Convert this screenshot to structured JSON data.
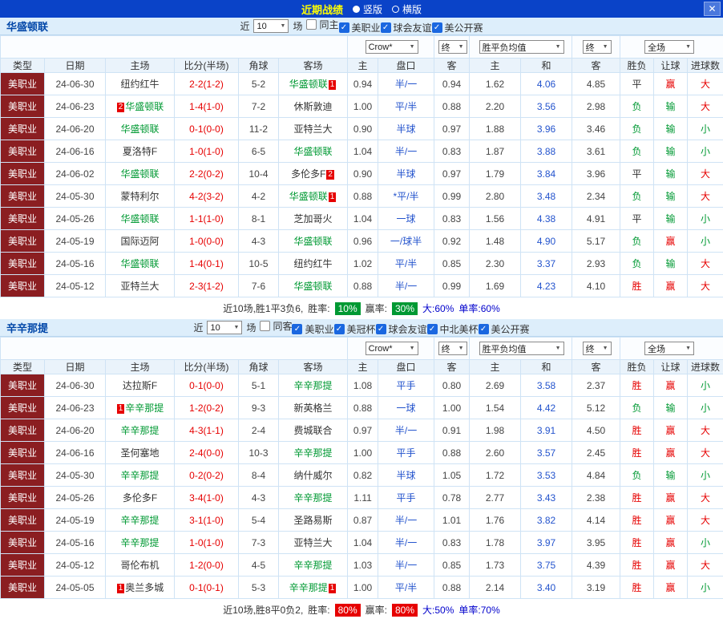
{
  "topbar": {
    "title": "近期战绩",
    "vertical": "竖版",
    "horizontal": "横版",
    "selected": "竖版"
  },
  "icons": {
    "check": "✓",
    "arrow_down": "▼",
    "close": "✕"
  },
  "colors": {
    "topbar_blue": "#0a43c8",
    "title_yellow": "#ffff00",
    "maroon": "#8b1e21",
    "win_red": "#e60000",
    "loss_green": "#009933",
    "odds_blue": "#2353cd",
    "rate_green": "#009933",
    "rate_red": "#e60000"
  },
  "filters_common": {
    "near": "近",
    "games": "10",
    "games_suffix": "场"
  },
  "dropdown_row": {
    "company": "Crow*",
    "company_final": "终",
    "europe": "胜平负均值",
    "europe_final": "终",
    "scope": "全场"
  },
  "table_header": {
    "labels": [
      "类型",
      "日期",
      "主场",
      "比分(半场)",
      "角球",
      "客场",
      "主",
      "盘口",
      "客",
      "主",
      "和",
      "客",
      "胜负",
      "让球",
      "进球数"
    ]
  },
  "sections": [
    {
      "team": "华盛顿联",
      "checkboxes": [
        {
          "label": "同主",
          "checked": false
        },
        {
          "label": "美职业",
          "checked": true
        },
        {
          "label": "球会友谊",
          "checked": true
        },
        {
          "label": "美公开赛",
          "checked": true
        }
      ],
      "rows": [
        [
          "美职业",
          "24-06-30",
          {
            "n": "纽约红牛"
          },
          "2-2(1-2)",
          "5-2",
          {
            "n": "华盛顿联",
            "f": true,
            "a": "1"
          },
          "0.94",
          "半/一",
          "0.94",
          "1.62",
          "4.06",
          "4.85",
          "平",
          "赢",
          "大"
        ],
        [
          "美职业",
          "24-06-23",
          {
            "n": "华盛顿联",
            "f": true,
            "b": "2"
          },
          "1-4(1-0)",
          "7-2",
          {
            "n": "休斯敦迪"
          },
          "1.00",
          "平/半",
          "0.88",
          "2.20",
          "3.56",
          "2.98",
          "负",
          "输",
          "大"
        ],
        [
          "美职业",
          "24-06-20",
          {
            "n": "华盛顿联",
            "f": true
          },
          "0-1(0-0)",
          "11-2",
          {
            "n": "亚特兰大"
          },
          "0.90",
          "半球",
          "0.97",
          "1.88",
          "3.96",
          "3.46",
          "负",
          "输",
          "小"
        ],
        [
          "美职业",
          "24-06-16",
          {
            "n": "夏洛特F"
          },
          "1-0(1-0)",
          "6-5",
          {
            "n": "华盛顿联",
            "f": true
          },
          "1.04",
          "半/一",
          "0.83",
          "1.87",
          "3.88",
          "3.61",
          "负",
          "输",
          "小"
        ],
        [
          "美职业",
          "24-06-02",
          {
            "n": "华盛顿联",
            "f": true
          },
          "2-2(0-2)",
          "10-4",
          {
            "n": "多伦多F",
            "a": "2"
          },
          "0.90",
          "半球",
          "0.97",
          "1.79",
          "3.84",
          "3.96",
          "平",
          "输",
          "大"
        ],
        [
          "美职业",
          "24-05-30",
          {
            "n": "蒙特利尔"
          },
          "4-2(3-2)",
          "4-2",
          {
            "n": "华盛顿联",
            "f": true,
            "a": "1"
          },
          "0.88",
          "*平/半",
          "0.99",
          "2.80",
          "3.48",
          "2.34",
          "负",
          "输",
          "大"
        ],
        [
          "美职业",
          "24-05-26",
          {
            "n": "华盛顿联",
            "f": true
          },
          "1-1(1-0)",
          "8-1",
          {
            "n": "芝加哥火"
          },
          "1.04",
          "一球",
          "0.83",
          "1.56",
          "4.38",
          "4.91",
          "平",
          "输",
          "小"
        ],
        [
          "美职业",
          "24-05-19",
          {
            "n": "国际迈阿"
          },
          "1-0(0-0)",
          "4-3",
          {
            "n": "华盛顿联",
            "f": true
          },
          "0.96",
          "一/球半",
          "0.92",
          "1.48",
          "4.90",
          "5.17",
          "负",
          "赢",
          "小"
        ],
        [
          "美职业",
          "24-05-16",
          {
            "n": "华盛顿联",
            "f": true
          },
          "1-4(0-1)",
          "10-5",
          {
            "n": "纽约红牛"
          },
          "1.02",
          "平/半",
          "0.85",
          "2.30",
          "3.37",
          "2.93",
          "负",
          "输",
          "大"
        ],
        [
          "美职业",
          "24-05-12",
          {
            "n": "亚特兰大"
          },
          "2-3(1-2)",
          "7-6",
          {
            "n": "华盛顿联",
            "f": true
          },
          "0.88",
          "半/一",
          "0.99",
          "1.69",
          "4.23",
          "4.10",
          "胜",
          "赢",
          "大"
        ]
      ],
      "summary": {
        "prefix": "近10场,胜1平3负6,",
        "rate_label": "胜率:",
        "rate": "10%",
        "rate_bg": "#009933",
        "profit_label": "赢率:",
        "profit": "30%",
        "profit_bg": "#009933",
        "big": "大:60%",
        "single": "单率:60%"
      }
    },
    {
      "team": "辛辛那提",
      "checkboxes": [
        {
          "label": "同客",
          "checked": false
        },
        {
          "label": "美职业",
          "checked": true
        },
        {
          "label": "美冠杯",
          "checked": true
        },
        {
          "label": "球会友谊",
          "checked": true
        },
        {
          "label": "中北美杯",
          "checked": true
        },
        {
          "label": "美公开赛",
          "checked": true
        }
      ],
      "rows": [
        [
          "美职业",
          "24-06-30",
          {
            "n": "达拉斯F"
          },
          "0-1(0-0)",
          "5-1",
          {
            "n": "辛辛那提",
            "f": true
          },
          "1.08",
          "平手",
          "0.80",
          "2.69",
          "3.58",
          "2.37",
          "胜",
          "赢",
          "小"
        ],
        [
          "美职业",
          "24-06-23",
          {
            "n": "辛辛那提",
            "f": true,
            "b": "1"
          },
          "1-2(0-2)",
          "9-3",
          {
            "n": "新英格兰"
          },
          "0.88",
          "一球",
          "1.00",
          "1.54",
          "4.42",
          "5.12",
          "负",
          "输",
          "小"
        ],
        [
          "美职业",
          "24-06-20",
          {
            "n": "辛辛那提",
            "f": true
          },
          "4-3(1-1)",
          "2-4",
          {
            "n": "费城联合"
          },
          "0.97",
          "半/一",
          "0.91",
          "1.98",
          "3.91",
          "4.50",
          "胜",
          "赢",
          "大"
        ],
        [
          "美职业",
          "24-06-16",
          {
            "n": "圣何塞地"
          },
          "2-4(0-0)",
          "10-3",
          {
            "n": "辛辛那提",
            "f": true
          },
          "1.00",
          "平手",
          "0.88",
          "2.60",
          "3.57",
          "2.45",
          "胜",
          "赢",
          "大"
        ],
        [
          "美职业",
          "24-05-30",
          {
            "n": "辛辛那提",
            "f": true
          },
          "0-2(0-2)",
          "8-4",
          {
            "n": "纳什威尔"
          },
          "0.82",
          "半球",
          "1.05",
          "1.72",
          "3.53",
          "4.84",
          "负",
          "输",
          "小"
        ],
        [
          "美职业",
          "24-05-26",
          {
            "n": "多伦多F"
          },
          "3-4(1-0)",
          "4-3",
          {
            "n": "辛辛那提",
            "f": true
          },
          "1.11",
          "平手",
          "0.78",
          "2.77",
          "3.43",
          "2.38",
          "胜",
          "赢",
          "大"
        ],
        [
          "美职业",
          "24-05-19",
          {
            "n": "辛辛那提",
            "f": true
          },
          "3-1(1-0)",
          "5-4",
          {
            "n": "圣路易斯"
          },
          "0.87",
          "半/一",
          "1.01",
          "1.76",
          "3.82",
          "4.14",
          "胜",
          "赢",
          "大"
        ],
        [
          "美职业",
          "24-05-16",
          {
            "n": "辛辛那提",
            "f": true
          },
          "1-0(1-0)",
          "7-3",
          {
            "n": "亚特兰大"
          },
          "1.04",
          "半/一",
          "0.83",
          "1.78",
          "3.97",
          "3.95",
          "胜",
          "赢",
          "小"
        ],
        [
          "美职业",
          "24-05-12",
          {
            "n": "哥伦布机"
          },
          "1-2(0-0)",
          "4-5",
          {
            "n": "辛辛那提",
            "f": true
          },
          "1.03",
          "半/一",
          "0.85",
          "1.73",
          "3.75",
          "4.39",
          "胜",
          "赢",
          "大"
        ],
        [
          "美职业",
          "24-05-05",
          {
            "n": "奥兰多城",
            "b": "1"
          },
          "0-1(0-1)",
          "5-3",
          {
            "n": "辛辛那提",
            "f": true,
            "a": "1"
          },
          "1.00",
          "平/半",
          "0.88",
          "2.14",
          "3.40",
          "3.19",
          "胜",
          "赢",
          "小"
        ]
      ],
      "summary": {
        "prefix": "近10场,胜8平0负2,",
        "rate_label": "胜率:",
        "rate": "80%",
        "rate_bg": "#e60000",
        "profit_label": "赢率:",
        "profit": "80%",
        "profit_bg": "#e60000",
        "big": "大:50%",
        "single": "单率:70%"
      }
    }
  ]
}
